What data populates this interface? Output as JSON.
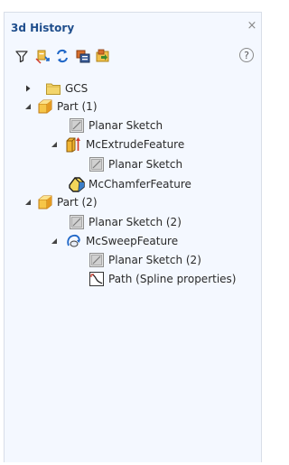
{
  "panel": {
    "title": "3d History",
    "close_glyph": "×"
  },
  "toolbar": {
    "buttons": [
      {
        "name": "filter-icon"
      },
      {
        "name": "locate-feature-icon"
      },
      {
        "name": "refresh-icon"
      },
      {
        "name": "expand-all-icon"
      },
      {
        "name": "collapse-all-icon"
      }
    ],
    "help_glyph": "?"
  },
  "tree": {
    "items": [
      {
        "label": "GCS",
        "icon": "folder-icon",
        "expanded": false
      },
      {
        "label": "Part (1)",
        "icon": "part-box-icon",
        "expanded": true
      },
      {
        "label": "Planar Sketch",
        "icon": "planar-sketch-icon"
      },
      {
        "label": "McExtrudeFeature",
        "icon": "extrude-feature-icon",
        "expanded": true
      },
      {
        "label": "Planar Sketch",
        "icon": "planar-sketch-icon"
      },
      {
        "label": "McChamferFeature",
        "icon": "chamfer-feature-icon"
      },
      {
        "label": "Part (2)",
        "icon": "part-box-icon",
        "expanded": true
      },
      {
        "label": "Planar Sketch (2)",
        "icon": "planar-sketch-icon"
      },
      {
        "label": "McSweepFeature",
        "icon": "sweep-feature-icon",
        "expanded": true
      },
      {
        "label": "Planar Sketch (2)",
        "icon": "planar-sketch-icon"
      },
      {
        "label": "Path (Spline properties)",
        "icon": "spline-path-icon"
      }
    ]
  },
  "colors": {
    "panel_bg": "#f4f8ff",
    "title_text": "#1f4e8c",
    "folder_yellow": "#e8c64a",
    "part_yellow": "#f2b533",
    "extrude_red": "#d23a2a"
  }
}
